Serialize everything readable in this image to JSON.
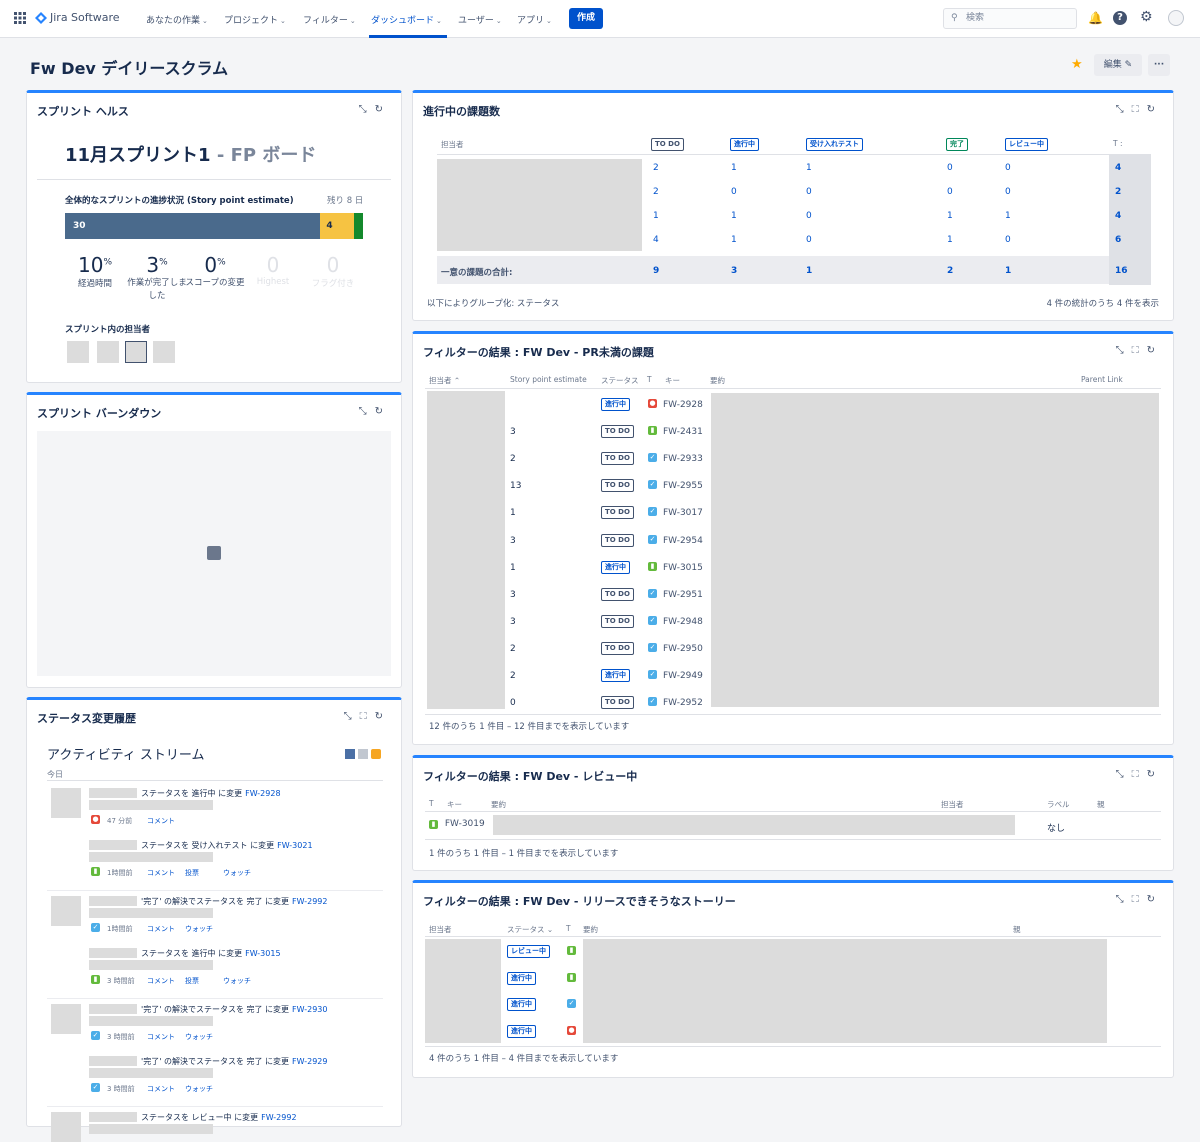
{
  "topbar": {
    "app_name": "Jira Software",
    "nav": [
      "あなたの作業",
      "プロジェクト",
      "フィルター",
      "ダッシュボード",
      "ユーザー",
      "アプリ"
    ],
    "create_label": "作成",
    "search_placeholder": "検索"
  },
  "page": {
    "title": "Fw Dev デイリースクラム",
    "edit_label": "編集",
    "more_label": "···"
  },
  "sprint_health": {
    "title": "スプリント ヘルス",
    "sprint_name": "11月スプリント1",
    "board_name": "FP ボード",
    "progress_label": "全体的なスプリントの進捗状況 (Story point estimate)",
    "remaining": "残り 8 日",
    "bar": {
      "todo": 30,
      "in_progress": 4,
      "done": 1
    },
    "bar_labels": {
      "todo": "30",
      "in_progress": "4"
    },
    "stats": [
      {
        "value": "10",
        "unit": "%",
        "label": "経過時間"
      },
      {
        "value": "3",
        "unit": "%",
        "label": "作業が完了しました"
      },
      {
        "value": "0",
        "unit": "%",
        "label": "スコープの変更"
      },
      {
        "value": "0",
        "unit": "",
        "label": "Highest"
      },
      {
        "value": "0",
        "unit": "",
        "label": "フラグ付き"
      }
    ],
    "assignees_label": "スプリント内の担当者"
  },
  "burndown": {
    "title": "スプリント バーンダウン"
  },
  "history": {
    "title": "ステータス変更履歴",
    "stream_title": "アクティビティ ストリーム",
    "today": "今日",
    "entries": [
      {
        "text": "ステータスを 進行中 に変更",
        "key": "FW-2928",
        "time": "47 分前",
        "actions": [
          "コメント"
        ],
        "type": "bug"
      },
      {
        "text": "ステータスを 受け入れテスト に変更",
        "key": "FW-3021",
        "time": "1時間前",
        "actions": [
          "コメント",
          "投票",
          "ウォッチ"
        ],
        "type": "story"
      },
      {
        "text": "'完了' の解決でステータスを 完了 に変更",
        "key": "FW-2992",
        "time": "1時間前",
        "actions": [
          "コメント",
          "ウォッチ"
        ],
        "type": "task"
      },
      {
        "text": "ステータスを 進行中 に変更",
        "key": "FW-3015",
        "time": "3 時間前",
        "actions": [
          "コメント",
          "投票",
          "ウォッチ"
        ],
        "type": "story"
      },
      {
        "text": "'完了' の解決でステータスを 完了 に変更",
        "key": "FW-2930",
        "time": "3 時間前",
        "actions": [
          "コメント",
          "ウォッチ"
        ],
        "type": "task"
      },
      {
        "text": "'完了' の解決でステータスを 完了 に変更",
        "key": "FW-2929",
        "time": "3 時間前",
        "actions": [
          "コメント",
          "ウォッチ"
        ],
        "type": "task"
      },
      {
        "text": "ステータスを レビュー中 に変更",
        "key": "FW-2992",
        "time": "",
        "actions": [],
        "type": "task"
      }
    ]
  },
  "in_progress": {
    "title": "進行中の課題数",
    "header": [
      "担当者",
      "TO DO",
      "進行中",
      "受け入れテスト",
      "完了",
      "レビュー中",
      "T :"
    ],
    "rows": [
      [
        "2",
        "1",
        "1",
        "0",
        "0",
        "4"
      ],
      [
        "2",
        "0",
        "0",
        "0",
        "0",
        "2"
      ],
      [
        "1",
        "1",
        "0",
        "1",
        "1",
        "4"
      ],
      [
        "4",
        "1",
        "0",
        "1",
        "0",
        "6"
      ]
    ],
    "total_label": "一意の課題の合計:",
    "totals": [
      "9",
      "3",
      "1",
      "2",
      "1",
      "16"
    ],
    "group_by": "以下によりグループ化: ステータス",
    "showing": "4 件の統計のうち 4 件を表示"
  },
  "filter_pr": {
    "title": "フィルターの結果 : FW Dev - PR未満の課題",
    "columns": [
      "担当者",
      "Story point estimate",
      "ステータス",
      "T",
      "キー",
      "要約",
      "Parent Link"
    ],
    "rows": [
      {
        "sp": "",
        "status": "進行中",
        "type": "bug",
        "key": "FW-2928"
      },
      {
        "sp": "3",
        "status": "TO DO",
        "type": "story",
        "key": "FW-2431"
      },
      {
        "sp": "2",
        "status": "TO DO",
        "type": "task",
        "key": "FW-2933"
      },
      {
        "sp": "13",
        "status": "TO DO",
        "type": "task",
        "key": "FW-2955"
      },
      {
        "sp": "1",
        "status": "TO DO",
        "type": "task",
        "key": "FW-3017"
      },
      {
        "sp": "3",
        "status": "TO DO",
        "type": "task",
        "key": "FW-2954"
      },
      {
        "sp": "1",
        "status": "進行中",
        "type": "story",
        "key": "FW-3015"
      },
      {
        "sp": "3",
        "status": "TO DO",
        "type": "task",
        "key": "FW-2951"
      },
      {
        "sp": "3",
        "status": "TO DO",
        "type": "task",
        "key": "FW-2948"
      },
      {
        "sp": "2",
        "status": "TO DO",
        "type": "task",
        "key": "FW-2950"
      },
      {
        "sp": "2",
        "status": "進行中",
        "type": "task",
        "key": "FW-2949"
      },
      {
        "sp": "0",
        "status": "TO DO",
        "type": "task",
        "key": "FW-2952"
      }
    ],
    "footer": "12 件のうち 1 件目 – 12 件目までを表示しています"
  },
  "filter_review": {
    "title": "フィルターの結果 : FW Dev - レビュー中",
    "columns": [
      "T",
      "キー",
      "要約",
      "担当者",
      "ラベル",
      "親"
    ],
    "rows": [
      {
        "type": "story",
        "key": "FW-3019",
        "label": "なし"
      }
    ],
    "footer": "1 件のうち 1 件目 – 1 件目までを表示しています"
  },
  "filter_release": {
    "title": "フィルターの結果 : FW Dev - リリースできそうなストーリー",
    "columns": [
      "担当者",
      "ステータス",
      "T",
      "要約",
      "親"
    ],
    "rows": [
      {
        "status": "レビュー中",
        "type": "story"
      },
      {
        "status": "進行中",
        "type": "story"
      },
      {
        "status": "進行中",
        "type": "task"
      },
      {
        "status": "進行中",
        "type": "bug"
      }
    ],
    "footer": "4 件のうち 1 件目 – 4 件目までを表示しています"
  },
  "colors": {
    "accent": "#0052cc",
    "todo_bar": "#4a6a8c",
    "inprogress_bar": "#f6c342",
    "done_bar": "#14892c",
    "gadget_border": "#2684ff"
  }
}
